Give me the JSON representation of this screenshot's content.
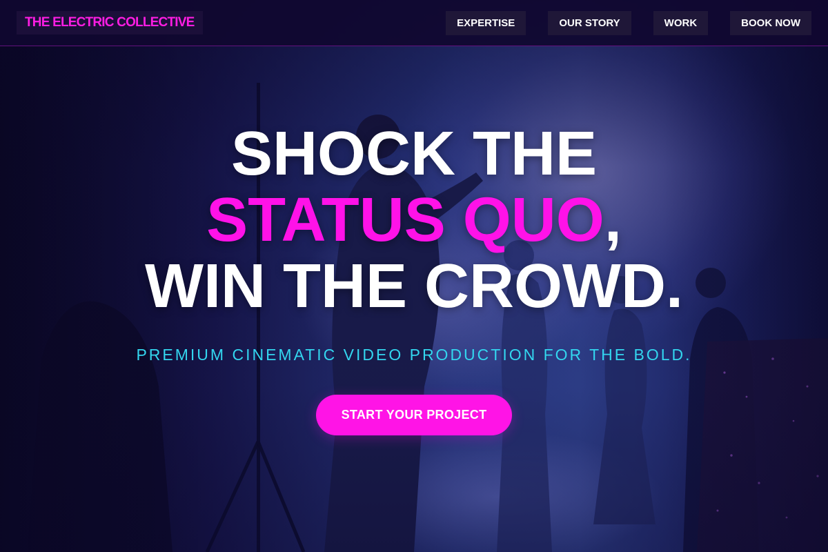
{
  "brand": {
    "name": "THE ELECTRIC COLLECTIVE"
  },
  "nav": {
    "items": [
      {
        "label": "EXPERTISE"
      },
      {
        "label": "OUR STORY"
      },
      {
        "label": "WORK"
      },
      {
        "label": "BOOK NOW"
      }
    ]
  },
  "hero": {
    "headline": {
      "line1": "SHOCK THE",
      "line2_accent": "STATUS QUO",
      "line2_tail": ",",
      "line3": "WIN THE CROWD."
    },
    "subheadline": "PREMIUM CINEMATIC VIDEO PRODUCTION FOR THE BOLD.",
    "cta_label": "START YOUR PROJECT"
  },
  "colors": {
    "accent_magenta": "#ff12e8",
    "accent_cyan": "#33d6ef",
    "header_bg": "#100830",
    "text_primary": "#ffffff"
  }
}
